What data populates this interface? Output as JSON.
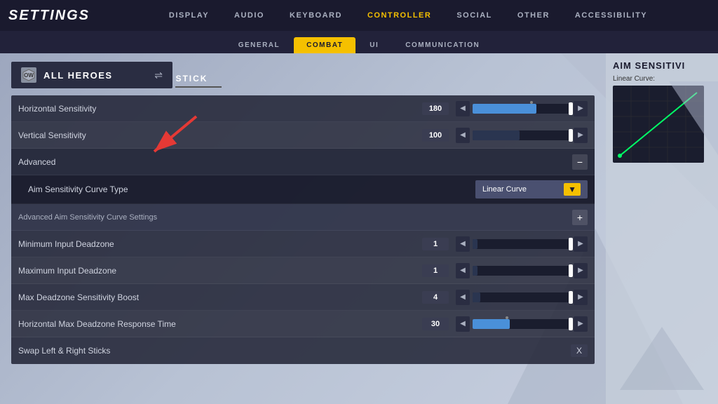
{
  "app": {
    "title": "SETTINGS"
  },
  "nav": {
    "items": [
      {
        "label": "DISPLAY",
        "active": false
      },
      {
        "label": "AUDIO",
        "active": false
      },
      {
        "label": "KEYBOARD",
        "active": false
      },
      {
        "label": "CONTROLLER",
        "active": true
      },
      {
        "label": "SOCIAL",
        "active": false
      },
      {
        "label": "OTHER",
        "active": false
      },
      {
        "label": "ACCESSIBILITY",
        "active": false
      }
    ]
  },
  "subnav": {
    "items": [
      {
        "label": "GENERAL",
        "active": false
      },
      {
        "label": "COMBAT",
        "active": true
      },
      {
        "label": "UI",
        "active": false
      },
      {
        "label": "COMMUNICATION",
        "active": false
      }
    ]
  },
  "hero_selector": {
    "label": "ALL HEROES",
    "icon": "⊡",
    "swap_icon": "⇌"
  },
  "section": {
    "stick_label": "STICK"
  },
  "settings": [
    {
      "label": "Horizontal Sensitivity",
      "value": "180",
      "slider_pct": 65,
      "has_pip": true,
      "pip_pct": 60
    },
    {
      "label": "Vertical Sensitivity",
      "value": "100",
      "slider_pct": 48,
      "has_pip": false
    },
    {
      "label": "Advanced",
      "is_header": true,
      "expand_icon": "−"
    },
    {
      "label": "Aim Sensitivity Curve Type",
      "is_dropdown": true,
      "dropdown_value": "Linear Curve"
    },
    {
      "label": "Advanced Aim Sensitivity Curve Settings",
      "is_curve_header": true,
      "expand_icon": "+"
    },
    {
      "label": "Minimum Input Deadzone",
      "value": "1",
      "slider_pct": 5,
      "has_pip": false
    },
    {
      "label": "Maximum Input Deadzone",
      "value": "1",
      "slider_pct": 5,
      "has_pip": false
    },
    {
      "label": "Max Deadzone Sensitivity Boost",
      "value": "4",
      "slider_pct": 8,
      "has_pip": false
    },
    {
      "label": "Horizontal Max Deadzone Response Time",
      "value": "30",
      "slider_pct": 38,
      "has_pip": true,
      "pip_pct": 35
    },
    {
      "label": "Swap Left & Right Sticks",
      "is_checkbox": true,
      "checkbox_value": "X"
    }
  ],
  "right_panel": {
    "title": "AIM SENSITIVI",
    "curve_label": "Linear Curve:"
  }
}
